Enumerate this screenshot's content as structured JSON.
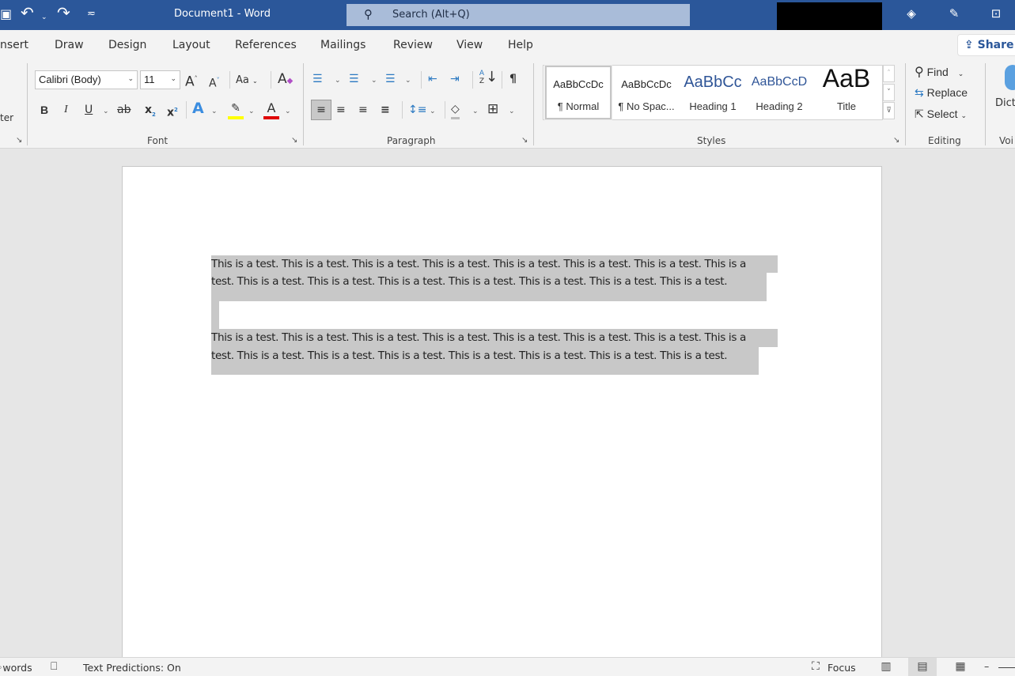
{
  "titlebar": {
    "title": "Document1  -  Word",
    "search_placeholder": "Search (Alt+Q)",
    "save_icon": "▣",
    "undo_icon": "↶",
    "redo_icon": "↷",
    "customize_icon": "≂",
    "diamond_icon": "◈",
    "pen_icon": "✎",
    "ribbon_display_icon": "⊡",
    "search_icon": "⚲"
  },
  "tabs": [
    "nsert",
    "Draw",
    "Design",
    "Layout",
    "References",
    "Mailings",
    "Review",
    "View",
    "Help"
  ],
  "share": {
    "label": "Share",
    "icon": "⇪"
  },
  "ribbon": {
    "clipboard": {
      "partial_label": "ter",
      "launcher": "↘"
    },
    "font": {
      "font_name": "Calibri (Body)",
      "font_size": "11",
      "grow_label": "A",
      "shrink_label": "A",
      "change_case_label": "Aa",
      "clear_format_label": "A",
      "bold": "B",
      "italic": "I",
      "underline": "U",
      "strikethrough": "ab",
      "subscript": "x",
      "superscript": "x",
      "text_effects": "A",
      "highlight": "✎",
      "font_color": "A",
      "group_label": "Font",
      "launcher": "↘",
      "highlight_color": "#ffff00",
      "font_color_value": "#e00000"
    },
    "paragraph": {
      "bullets": "☰",
      "numbering": "☰",
      "multilevel": "☰",
      "decrease_indent": "⇤",
      "increase_indent": "⇥",
      "sort": "↓",
      "sort_letters": "AZ",
      "show_marks": "¶",
      "align_left": "≡",
      "align_center": "≡",
      "align_right": "≡",
      "justify": "≡",
      "line_spacing": "↕≡",
      "shading": "◇",
      "borders": "⊞",
      "group_label": "Paragraph",
      "launcher": "↘"
    },
    "styles": {
      "items": [
        {
          "preview": "AaBbCcDc",
          "name": "¶ Normal",
          "selected": true
        },
        {
          "preview": "AaBbCcDc",
          "name": "¶ No Spac...",
          "selected": false
        },
        {
          "preview": "AaBbCc",
          "name": "Heading 1",
          "selected": false
        },
        {
          "preview": "AaBbCcD",
          "name": "Heading 2",
          "selected": false
        },
        {
          "preview": "AaB",
          "name": "Title",
          "selected": false
        }
      ],
      "group_label": "Styles",
      "launcher": "↘",
      "scroll_up": "˄",
      "scroll_down": "˅",
      "more": "⊽"
    },
    "editing": {
      "find_label": "Find",
      "replace_label": "Replace",
      "select_label": "Select",
      "find_icon": "⚲",
      "replace_icon": "⇆",
      "select_icon": "⇱",
      "group_label": "Editing"
    },
    "voice": {
      "dictate_label": "Dict",
      "group_label": "Voi"
    }
  },
  "document": {
    "paragraphs": [
      {
        "lines": [
          "This is a test. This is a test. This is a test. This is a test. This is a test. This is a test. This is a test. This is a",
          "test. This is a test. This is a test. This is a test. This is a test. This is a test. This is a test. This is a test."
        ]
      },
      {
        "lines": [
          ""
        ]
      },
      {
        "lines": [
          "This is a test. This is a test. This is a test. This is a test. This is a test. This is a test. This is a test. This is a",
          "test. This is a test. This is a test. This is a test. This is a test. This is a test. This is a test. This is a test."
        ]
      }
    ],
    "selection_color": "#c8c8c8"
  },
  "statusbar": {
    "word_count": "words",
    "proofing_icon": "📖",
    "text_predictions": "Text Predictions: On",
    "focus_label": "Focus",
    "focus_icon": "⛶",
    "read_mode_icon": "▥",
    "print_layout_icon": "▤",
    "web_layout_icon": "▦",
    "zoom_out": "–"
  },
  "colors": {
    "title_bar": "#2b579a",
    "ribbon_bg": "#f3f3f3",
    "canvas_bg": "#e6e6e6",
    "accent": "#2b579a"
  }
}
